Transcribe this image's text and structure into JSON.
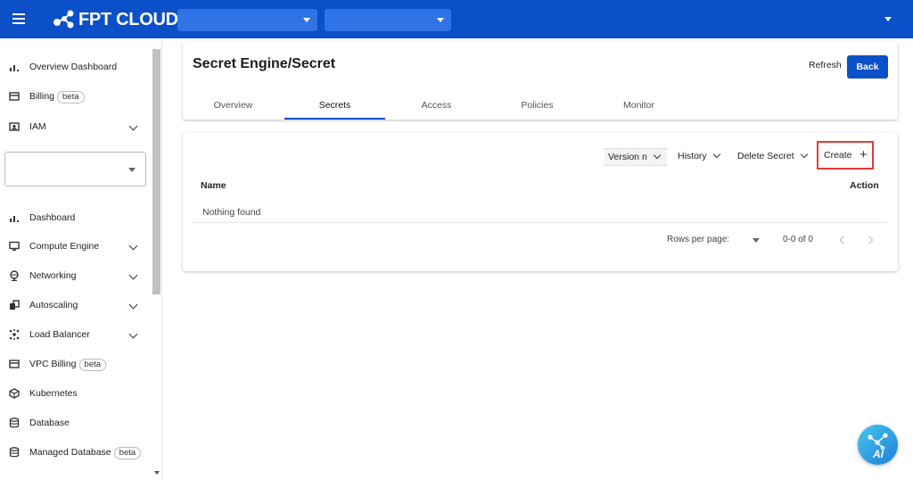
{
  "header": {
    "brand": "FPT CLOUD",
    "selects": [
      {
        "value": ""
      },
      {
        "value": ""
      }
    ]
  },
  "sidebar": {
    "items_top": [
      {
        "label": "Overview Dashboard",
        "icon": "bar-chart-icon"
      },
      {
        "label": "Billing",
        "icon": "billing-icon",
        "badge": "beta"
      },
      {
        "label": "IAM",
        "icon": "iam-icon",
        "expandable": true
      }
    ],
    "project_select": {
      "value": ""
    },
    "items": [
      {
        "label": "Dashboard",
        "icon": "bar-chart-icon"
      },
      {
        "label": "Compute Engine",
        "icon": "monitor-icon",
        "expandable": true
      },
      {
        "label": "Networking",
        "icon": "globe-icon",
        "expandable": true
      },
      {
        "label": "Autoscaling",
        "icon": "autoscaling-icon",
        "expandable": true
      },
      {
        "label": "Load Balancer",
        "icon": "load-balancer-icon",
        "expandable": true
      },
      {
        "label": "VPC Billing",
        "icon": "billing-icon",
        "badge": "beta"
      },
      {
        "label": "Kubernetes",
        "icon": "cube-icon"
      },
      {
        "label": "Database",
        "icon": "database-icon"
      },
      {
        "label": "Managed Database",
        "icon": "database-icon",
        "badge": "beta"
      }
    ]
  },
  "page": {
    "title": "Secret Engine/Secret",
    "refresh_label": "Refresh",
    "back_label": "Back",
    "tabs": [
      {
        "label": "Overview"
      },
      {
        "label": "Secrets",
        "active": true
      },
      {
        "label": "Access"
      },
      {
        "label": "Policies"
      },
      {
        "label": "Monitor"
      }
    ]
  },
  "table": {
    "toolbar": {
      "version_label": "Version n",
      "history_label": "History",
      "delete_label": "Delete Secret",
      "create_label": "Create"
    },
    "columns": [
      "Name",
      "Action"
    ],
    "empty_text": "Nothing found",
    "rows_per_page_label": "Rows per page:",
    "range_text": "0-0 of 0"
  },
  "fab": {
    "label": "AI"
  },
  "colors": {
    "primary": "#0b4fc9",
    "highlight": "#e53935"
  }
}
